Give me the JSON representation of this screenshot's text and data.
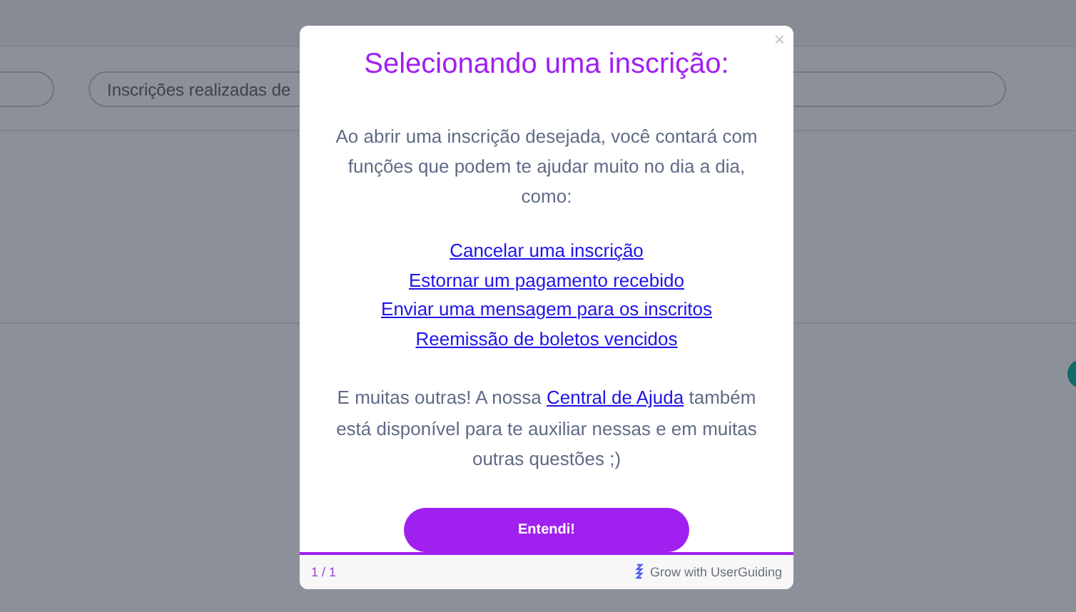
{
  "background": {
    "search": {
      "placeholder": "Inscrições realizadas de"
    }
  },
  "modal": {
    "title": "Selecionando uma inscrição:",
    "intro": "Ao abrir uma inscrição desejada, você contará com funções que podem te ajudar muito no dia a dia, como:",
    "links": [
      "Cancelar uma inscrição",
      "Estornar um pagamento recebido",
      "Enviar uma mensagem para os inscritos",
      "Reemissão de boletos vencidos"
    ],
    "outro_before": "E muitas outras! A nossa ",
    "outro_link": "Central de Ajuda",
    "outro_after": " também está disponível para te auxiliar nessas e em muitas outras questões ;)",
    "button": "Entendi!",
    "close": "×",
    "progress": {
      "level": 1,
      "step": "1 / 1"
    },
    "branding": "Grow with UserGuiding"
  }
}
